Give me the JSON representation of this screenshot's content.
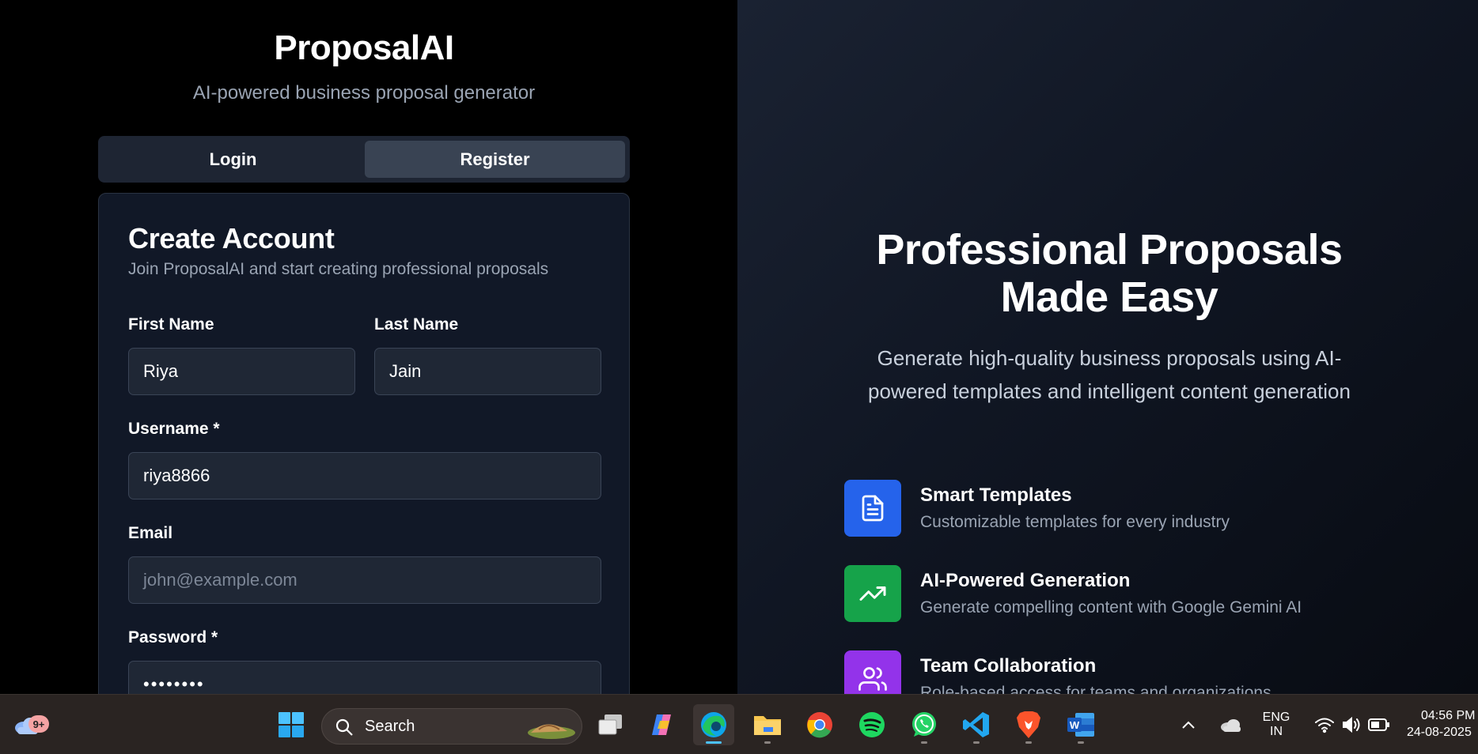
{
  "brand": {
    "title": "ProposalAI",
    "subtitle": "AI-powered business proposal generator"
  },
  "tabs": [
    {
      "label": "Login",
      "active": false
    },
    {
      "label": "Register",
      "active": true
    }
  ],
  "form": {
    "title": "Create Account",
    "subtitle": "Join ProposalAI and start creating professional proposals",
    "first_name": {
      "label": "First Name",
      "value": "Riya"
    },
    "last_name": {
      "label": "Last Name",
      "value": "Jain"
    },
    "username": {
      "label": "Username *",
      "value": "riya8866"
    },
    "email": {
      "label": "Email",
      "value": "",
      "placeholder": "john@example.com"
    },
    "password": {
      "label": "Password *",
      "value": "••••••••"
    }
  },
  "hero": {
    "title_line1": "Professional Proposals",
    "title_line2": "Made Easy",
    "description": "Generate high-quality business proposals using AI-powered templates and intelligent content generation"
  },
  "features": [
    {
      "title": "Smart Templates",
      "description": "Customizable templates for every industry",
      "icon": "document-icon",
      "color": "#2563eb"
    },
    {
      "title": "AI-Powered Generation",
      "description": "Generate compelling content with Google Gemini AI",
      "icon": "trending-up-icon",
      "color": "#16a34a"
    },
    {
      "title": "Team Collaboration",
      "description": "Role-based access for teams and organizations",
      "icon": "users-icon",
      "color": "#9333ea"
    }
  ],
  "taskbar": {
    "weather_badge": "9+",
    "search_label": "Search",
    "lang_line1": "ENG",
    "lang_line2": "IN",
    "time": "04:56 PM",
    "date": "24-08-2025",
    "apps": [
      "task-view",
      "copilot",
      "edge",
      "file-explorer",
      "chrome",
      "spotify",
      "whatsapp",
      "vscode",
      "brave",
      "word"
    ]
  }
}
